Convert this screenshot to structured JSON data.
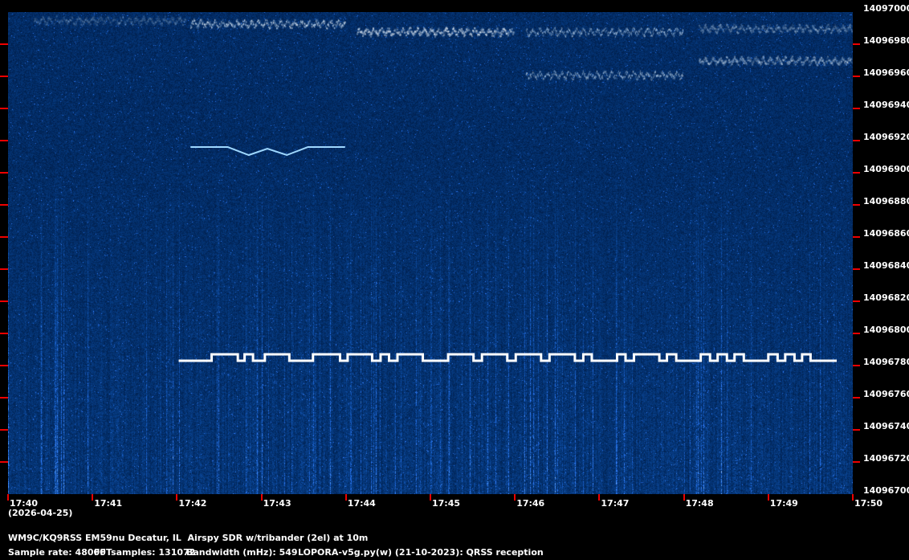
{
  "chart_data": {
    "type": "heatmap",
    "title": "QRSS spectrogram",
    "x_ticks": [
      "17:40",
      "17:41",
      "17:42",
      "17:43",
      "17:44",
      "17:45",
      "17:46",
      "17:47",
      "17:48",
      "17:49",
      "17:50"
    ],
    "x_range_minutes_after_1740": [
      0,
      10
    ],
    "date_label": "(2026-04-25)",
    "y_ticks": [
      "14097000",
      "14096980",
      "14096960",
      "14096940",
      "14096920",
      "14096900",
      "14096880",
      "14096860",
      "14096840",
      "14096820",
      "14096800",
      "14096780",
      "14096760",
      "14096740",
      "14096720",
      "14096700"
    ],
    "ylim": [
      14096700,
      14097000
    ],
    "fsk_signal": {
      "low_hz": 14096783,
      "high_hz": 14096787,
      "transitions_min": [
        2.02,
        2.41,
        2.72,
        2.8,
        2.9,
        3.04,
        3.33,
        3.61,
        3.93,
        4.02,
        4.31,
        4.41,
        4.51,
        4.61,
        4.91,
        5.21,
        5.51,
        5.61,
        5.91,
        6.01,
        6.31,
        6.41,
        6.71,
        6.81,
        6.91,
        7.21,
        7.31,
        7.41,
        7.71,
        7.8,
        7.91,
        8.2,
        8.31,
        8.4,
        8.51,
        8.6,
        8.71,
        9.0,
        9.11,
        9.2,
        9.31,
        9.4,
        9.5,
        9.81
      ]
    },
    "v_signal": {
      "points": [
        [
          2.16,
          14096916
        ],
        [
          2.6,
          14096916
        ],
        [
          2.85,
          14096911
        ],
        [
          3.07,
          14096915
        ],
        [
          3.3,
          14096911
        ],
        [
          3.55,
          14096916
        ],
        [
          3.99,
          14096916
        ]
      ]
    },
    "bands": [
      {
        "t0": 0.3,
        "t1": 2.1,
        "hz": 14096995,
        "intensity": 0.35
      },
      {
        "t0": 2.16,
        "t1": 3.99,
        "hz": 14096993,
        "intensity": 0.85
      },
      {
        "t0": 4.13,
        "t1": 5.99,
        "hz": 14096988,
        "intensity": 1.0
      },
      {
        "t0": 6.13,
        "t1": 7.99,
        "hz": 14096988,
        "intensity": 0.6
      },
      {
        "t0": 6.13,
        "t1": 7.99,
        "hz": 14096961,
        "intensity": 0.6
      },
      {
        "t0": 8.18,
        "t1": 9.99,
        "hz": 14096990,
        "intensity": 0.55
      },
      {
        "t0": 8.18,
        "t1": 9.99,
        "hz": 14096970,
        "intensity": 0.75
      }
    ]
  },
  "footer": {
    "station": "WM9C/KQ9RSS EM59nu Decatur, IL  Airspy SDR w/tribander (2el) at 10m",
    "sample_rate": "Sample rate: 48000",
    "fft": "FFTsamples: 131072",
    "bandwidth": "Bandwidth (mHz): 549",
    "software": "LOPORA-v5g.py(w) (21-10-2023): QRSS reception"
  },
  "colors": {
    "tick": "#ee0000",
    "trace": "#ffffff",
    "background": "#020b36"
  }
}
